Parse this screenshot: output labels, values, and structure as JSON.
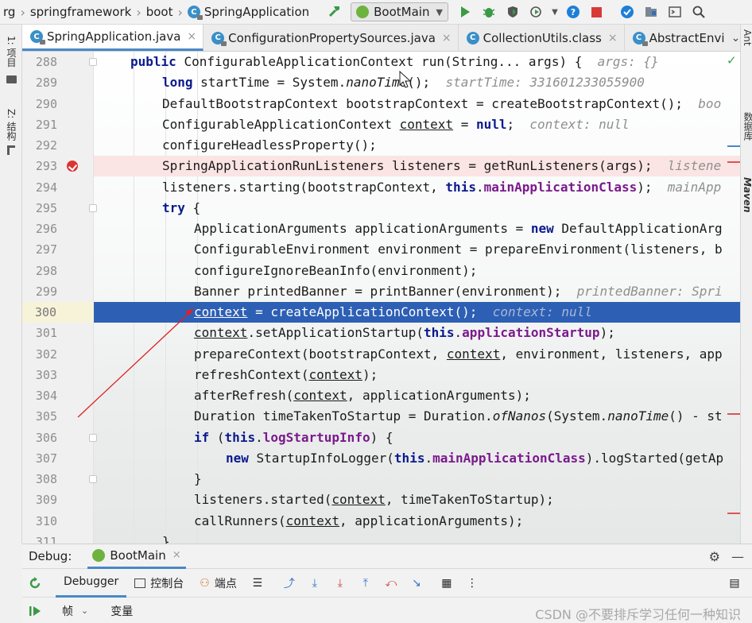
{
  "breadcrumb": {
    "items": [
      "rg",
      "springframework",
      "boot",
      "SpringApplication"
    ]
  },
  "toolbar": {
    "run_config": "BootMain"
  },
  "tabs": [
    {
      "label": "SpringApplication.java",
      "active": true,
      "closable": true
    },
    {
      "label": "ConfigurationPropertySources.java",
      "active": false,
      "closable": true
    },
    {
      "label": "CollectionUtils.class",
      "active": false,
      "closable": true
    },
    {
      "label": "AbstractEnvi",
      "active": false,
      "closable": false
    }
  ],
  "left_strip": {
    "project": "1: 项目",
    "structure": "Z: 结构"
  },
  "right_strip": {
    "ant": "Ant",
    "database": "数据库",
    "maven": "Maven"
  },
  "editor": {
    "lines": [
      {
        "num": "288",
        "indent": 1,
        "code": [
          [
            "kw",
            "public "
          ],
          [
            "t",
            "ConfigurableApplicationContext run(String... args) {"
          ]
        ],
        "hint": "args: {}"
      },
      {
        "num": "289",
        "indent": 2,
        "code": [
          [
            "kw",
            "long "
          ],
          [
            "t",
            "startTime = System."
          ],
          [
            "it",
            "nanoTime"
          ],
          [
            "t",
            "();"
          ]
        ],
        "hint": "startTime: 331601233055900"
      },
      {
        "num": "290",
        "indent": 2,
        "code": [
          [
            "t",
            "DefaultBootstrapContext bootstrapContext = createBootstrapContext();"
          ]
        ],
        "hint": "boo"
      },
      {
        "num": "291",
        "indent": 2,
        "code": [
          [
            "t",
            "ConfigurableApplicationContext "
          ],
          [
            "ul",
            "context"
          ],
          [
            "t",
            " = "
          ],
          [
            "kw",
            "null"
          ],
          [
            "t",
            ";"
          ]
        ],
        "hint": "context: null"
      },
      {
        "num": "292",
        "indent": 2,
        "code": [
          [
            "t",
            "configureHeadlessProperty();"
          ]
        ],
        "hint": ""
      },
      {
        "num": "293",
        "indent": 2,
        "code": [
          [
            "t",
            "SpringApplicationRunListeners listeners = getRunListeners(args);"
          ]
        ],
        "hint": "listene"
      },
      {
        "num": "294",
        "indent": 2,
        "code": [
          [
            "t",
            "listeners.starting(bootstrapContext, "
          ],
          [
            "kw",
            "this"
          ],
          [
            "t",
            "."
          ],
          [
            "fld",
            "mainApplicationClass"
          ],
          [
            "t",
            ");"
          ]
        ],
        "hint": "mainApp"
      },
      {
        "num": "295",
        "indent": 2,
        "code": [
          [
            "kw",
            "try "
          ],
          [
            "t",
            "{"
          ]
        ],
        "hint": ""
      },
      {
        "num": "296",
        "indent": 3,
        "code": [
          [
            "t",
            "ApplicationArguments applicationArguments = "
          ],
          [
            "kw",
            "new "
          ],
          [
            "t",
            "DefaultApplicationArg"
          ]
        ],
        "hint": ""
      },
      {
        "num": "297",
        "indent": 3,
        "code": [
          [
            "t",
            "ConfigurableEnvironment environment = prepareEnvironment(listeners, b"
          ]
        ],
        "hint": ""
      },
      {
        "num": "298",
        "indent": 3,
        "code": [
          [
            "t",
            "configureIgnoreBeanInfo(environment);"
          ]
        ],
        "hint": ""
      },
      {
        "num": "299",
        "indent": 3,
        "code": [
          [
            "t",
            "Banner printedBanner = printBanner(environment);"
          ]
        ],
        "hint": "printedBanner: Spri"
      },
      {
        "num": "300",
        "indent": 3,
        "code": [
          [
            "ul",
            "context"
          ],
          [
            "t",
            " = createApplicationContext();"
          ]
        ],
        "hint": "context: null"
      },
      {
        "num": "301",
        "indent": 3,
        "code": [
          [
            "ul",
            "context"
          ],
          [
            "t",
            ".setApplicationStartup("
          ],
          [
            "kw",
            "this"
          ],
          [
            "t",
            "."
          ],
          [
            "fld",
            "applicationStartup"
          ],
          [
            "t",
            ");"
          ]
        ],
        "hint": ""
      },
      {
        "num": "302",
        "indent": 3,
        "code": [
          [
            "t",
            "prepareContext(bootstrapContext, "
          ],
          [
            "ul",
            "context"
          ],
          [
            "t",
            ", environment, listeners, app"
          ]
        ],
        "hint": ""
      },
      {
        "num": "303",
        "indent": 3,
        "code": [
          [
            "t",
            "refreshContext("
          ],
          [
            "ul",
            "context"
          ],
          [
            "t",
            ");"
          ]
        ],
        "hint": ""
      },
      {
        "num": "304",
        "indent": 3,
        "code": [
          [
            "t",
            "afterRefresh("
          ],
          [
            "ul",
            "context"
          ],
          [
            "t",
            ", applicationArguments);"
          ]
        ],
        "hint": ""
      },
      {
        "num": "305",
        "indent": 3,
        "code": [
          [
            "t",
            "Duration timeTakenToStartup = Duration."
          ],
          [
            "it",
            "ofNanos"
          ],
          [
            "t",
            "(System."
          ],
          [
            "it",
            "nanoTime"
          ],
          [
            "t",
            "() - st"
          ]
        ],
        "hint": ""
      },
      {
        "num": "306",
        "indent": 3,
        "code": [
          [
            "kw",
            "if "
          ],
          [
            "t",
            "("
          ],
          [
            "kw",
            "this"
          ],
          [
            "t",
            "."
          ],
          [
            "fld",
            "logStartupInfo"
          ],
          [
            "t",
            ") {"
          ]
        ],
        "hint": ""
      },
      {
        "num": "307",
        "indent": 4,
        "code": [
          [
            "kw",
            "new "
          ],
          [
            "t",
            "StartupInfoLogger("
          ],
          [
            "kw",
            "this"
          ],
          [
            "t",
            "."
          ],
          [
            "fld",
            "mainApplicationClass"
          ],
          [
            "t",
            ").logStarted(getAp"
          ]
        ],
        "hint": ""
      },
      {
        "num": "308",
        "indent": 3,
        "code": [
          [
            "t",
            "}"
          ]
        ],
        "hint": ""
      },
      {
        "num": "309",
        "indent": 3,
        "code": [
          [
            "t",
            "listeners.started("
          ],
          [
            "ul",
            "context"
          ],
          [
            "t",
            ", timeTakenToStartup);"
          ]
        ],
        "hint": ""
      },
      {
        "num": "310",
        "indent": 3,
        "code": [
          [
            "t",
            "callRunners("
          ],
          [
            "ul",
            "context"
          ],
          [
            "t",
            ", applicationArguments);"
          ]
        ],
        "hint": ""
      },
      {
        "num": "311",
        "indent": 2,
        "code": [
          [
            "t",
            "}"
          ]
        ],
        "hint": ""
      }
    ],
    "breakpoint_line": "293",
    "current_line": "300"
  },
  "debug": {
    "title": "Debug:",
    "session": "BootMain",
    "tabs": [
      "Debugger",
      "控制台",
      "端点"
    ],
    "frames_label": "帧",
    "variables_label": "变量"
  },
  "watermark": "CSDN @不要排斥学习任何一种知识",
  "colors": {
    "accent": "#4a88c7",
    "current_line": "#2d5fb4",
    "breakpoint_line": "#fbe4e4",
    "breakpoint": "#dd3333",
    "annotation_arrow": "#e02020"
  }
}
